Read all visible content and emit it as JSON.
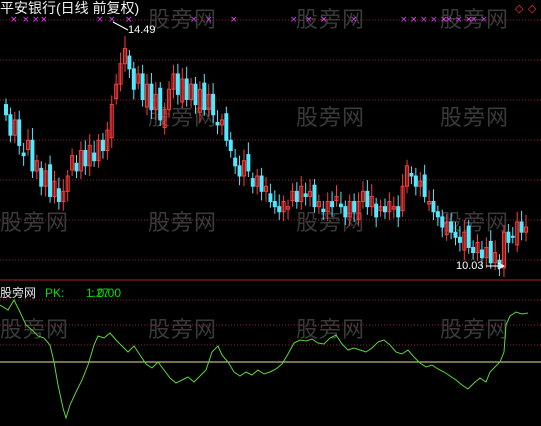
{
  "chart_title": "平安银行(日线 前复权)",
  "watermark": "股旁网",
  "price_panel": {
    "high_label": "14.49",
    "low_label": "10.03",
    "top_right_icons": [
      "diamond-red-icon",
      "diamond-red-icon"
    ],
    "candle_up_color": "#ff3b3b",
    "candle_down_color": "#54e8ff",
    "grid_color": "#8b2323"
  },
  "indicator_panel": {
    "name": "股旁网",
    "label": "PK:",
    "value": "1.27",
    "value2": ": 0.00",
    "label_color": "#00e000",
    "line_color": "#5cd63a",
    "baseline_color": "#e8e890"
  },
  "chart_data": [
    {
      "type": "candlestick",
      "title": "平安银行(日线 前复权)",
      "annotations": [
        {
          "text": "14.49"
        },
        {
          "text": "10.03"
        }
      ],
      "note": "price candles approximate, y-range ~9.9 to ~14.7"
    },
    {
      "type": "line",
      "series": [
        {
          "name": "PK",
          "last": "1.27"
        }
      ],
      "ylim": [
        -0.1,
        1.5
      ]
    }
  ]
}
